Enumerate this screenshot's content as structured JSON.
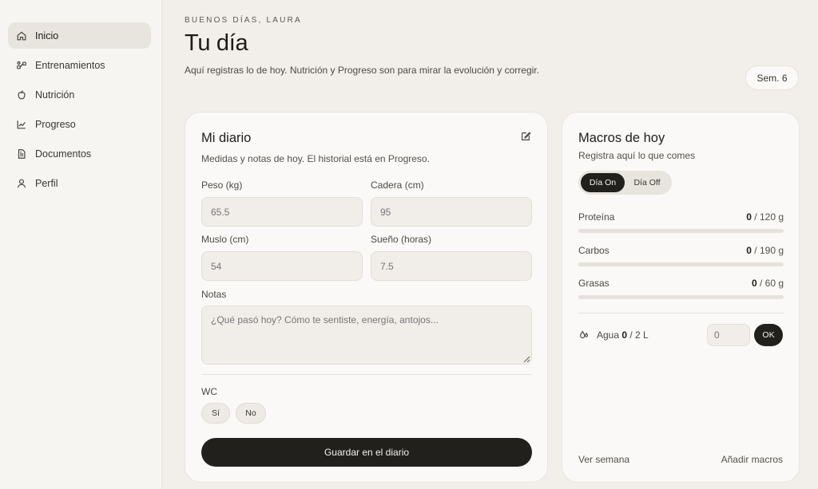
{
  "sidebar": {
    "items": [
      {
        "label": "Inicio",
        "icon": "home-icon",
        "active": true
      },
      {
        "label": "Entrenamientos",
        "icon": "workouts-icon",
        "active": false
      },
      {
        "label": "Nutrición",
        "icon": "apple-icon",
        "active": false
      },
      {
        "label": "Progreso",
        "icon": "chart-line-icon",
        "active": false
      },
      {
        "label": "Documentos",
        "icon": "document-icon",
        "active": false
      },
      {
        "label": "Perfil",
        "icon": "user-icon",
        "active": false
      }
    ]
  },
  "header": {
    "greeting": "BUENOS DÍAS, LAURA",
    "title": "Tu día",
    "subtitle": "Aquí registras lo de hoy. Nutrición y Progreso son para mirar la evolución y corregir.",
    "week_badge": "Sem. 6"
  },
  "diary": {
    "title": "Mi diario",
    "description": "Medidas y notas de hoy. El historial está en Progreso.",
    "fields": {
      "peso": {
        "label": "Peso (kg)",
        "placeholder": "65.5"
      },
      "cadera": {
        "label": "Cadera (cm)",
        "placeholder": "95"
      },
      "muslo": {
        "label": "Muslo (cm)",
        "placeholder": "54"
      },
      "sueno": {
        "label": "Sueño (horas)",
        "placeholder": "7.5"
      }
    },
    "notes": {
      "label": "Notas",
      "placeholder": "¿Qué pasó hoy? Cómo te sentiste, energía, antojos..."
    },
    "wc": {
      "label": "WC",
      "yes": "Sí",
      "no": "No"
    },
    "save_label": "Guardar en el diario"
  },
  "macros": {
    "title": "Macros de hoy",
    "description": "Registra aquí lo que comes",
    "toggle": {
      "on": "Día On",
      "off": "Día Off"
    },
    "items": [
      {
        "name": "Proteína",
        "current": "0",
        "target": " / 120 g",
        "progress": 0
      },
      {
        "name": "Carbos",
        "current": "0",
        "target": " / 190 g",
        "progress": 0
      },
      {
        "name": "Grasas",
        "current": "0",
        "target": " / 60 g",
        "progress": 0
      }
    ],
    "water": {
      "label": "Agua ",
      "current": "0",
      "target": " / 2 L",
      "input_placeholder": "0",
      "ok_label": "OK"
    },
    "links": {
      "week": "Ver semana",
      "add": "Añadir macros"
    }
  },
  "colors": {
    "accent": "#22201d",
    "background": "#f2efeb",
    "card": "#faf9f7"
  }
}
